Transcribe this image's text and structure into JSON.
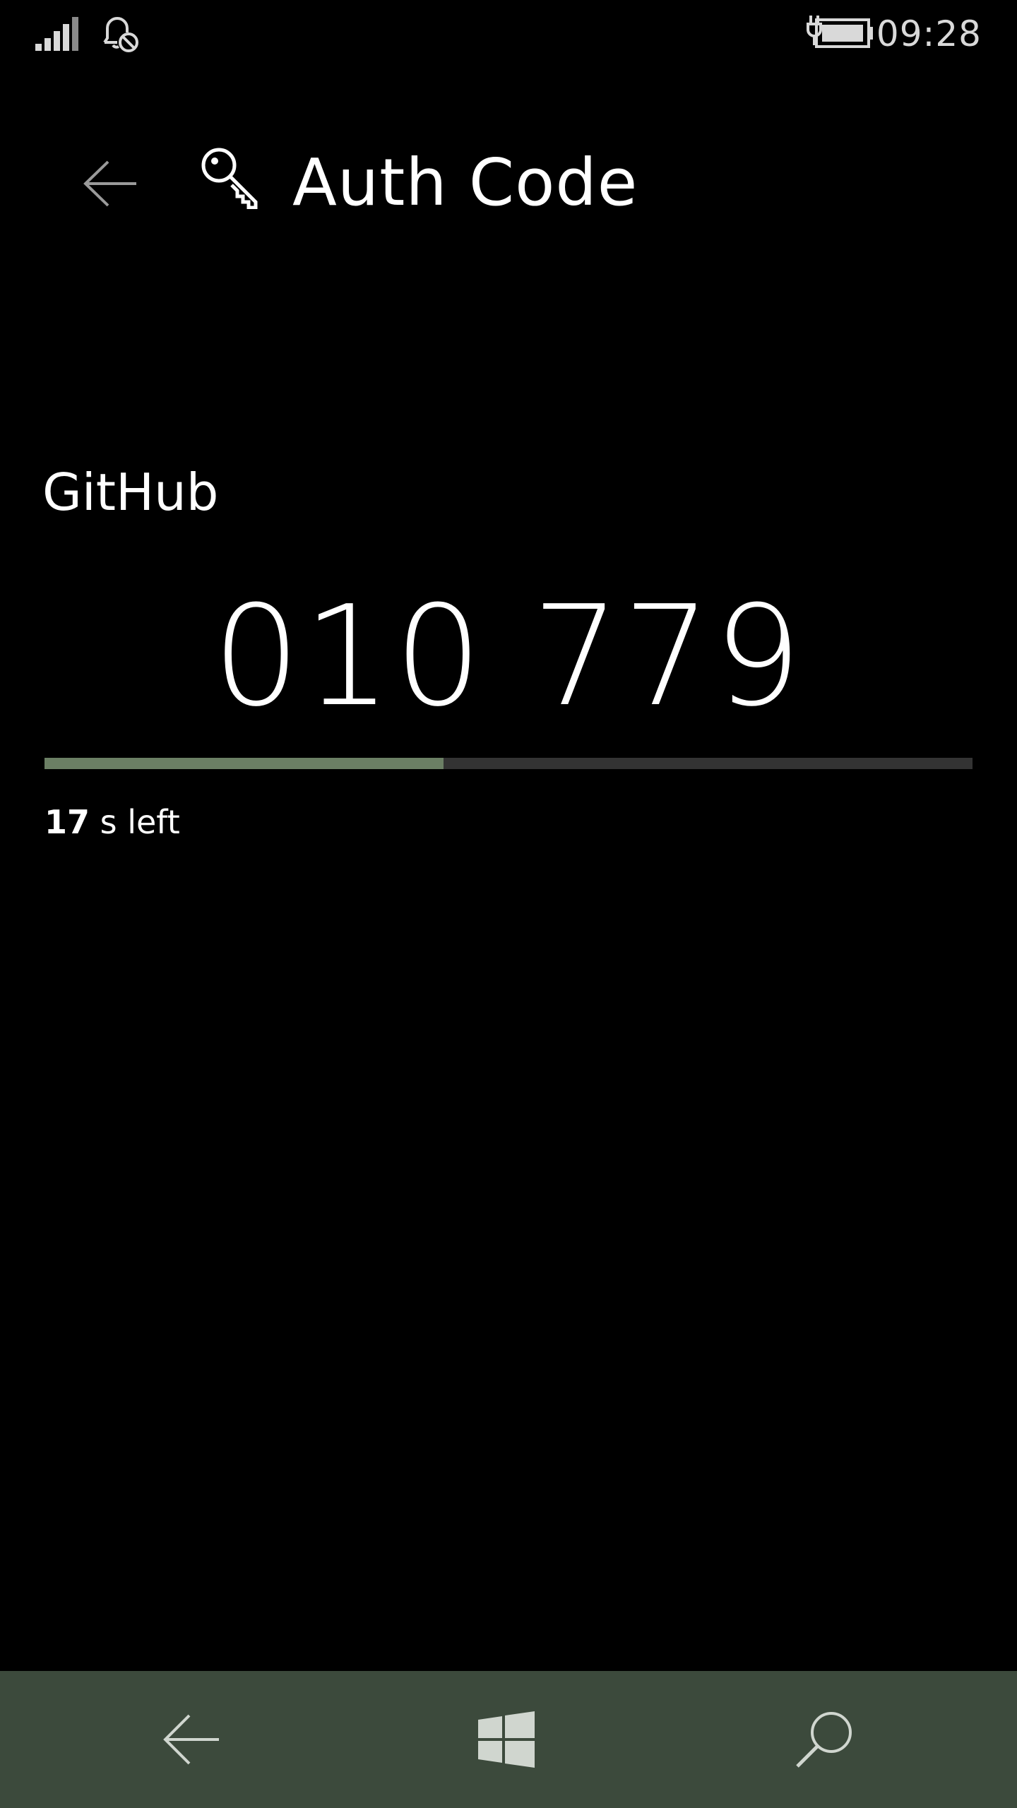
{
  "status_bar": {
    "time": "09:28",
    "icons": [
      "signal-icon",
      "alarm-off-icon",
      "battery-charging-icon"
    ]
  },
  "header": {
    "title": "Auth Code",
    "back_icon": "back-arrow-icon",
    "app_icon": "key-icon"
  },
  "account": {
    "name": "GitHub",
    "code": "010 779"
  },
  "timer": {
    "seconds_left": "17",
    "suffix": " s left",
    "progress": 0.43,
    "progress_color": "#6b7f64",
    "track_color": "#333333"
  },
  "nav_bar": {
    "background": "#3c4a3c",
    "buttons": [
      "back-arrow-icon",
      "windows-start-icon",
      "search-icon"
    ]
  }
}
